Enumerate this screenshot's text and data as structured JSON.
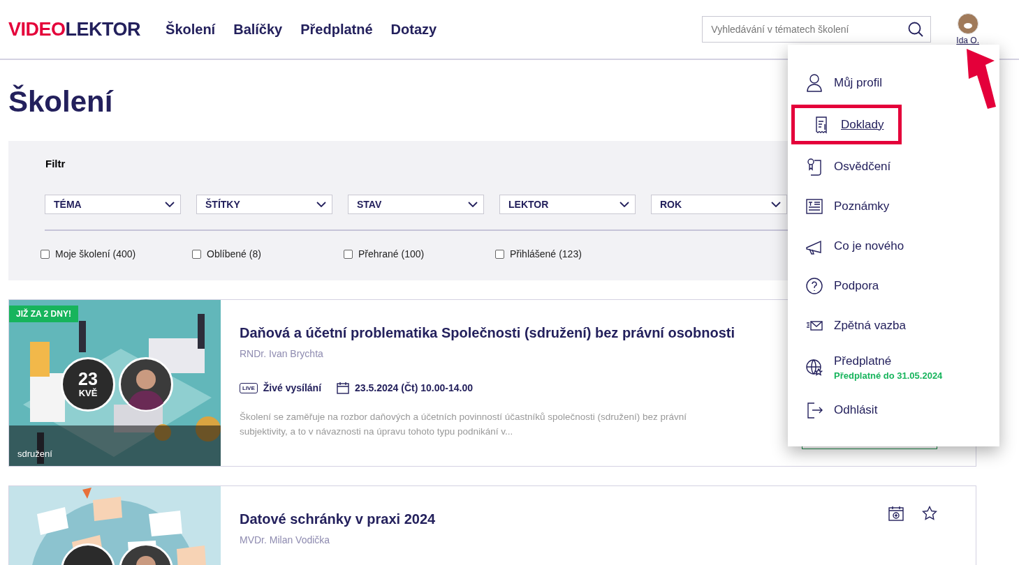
{
  "logo": {
    "part_1": "VIDEO",
    "part_2": "LEKTOR"
  },
  "nav": [
    "Školení",
    "Balíčky",
    "Předplatné",
    "Dotazy"
  ],
  "search": {
    "placeholder": "Vyhledávání v tématech školení"
  },
  "user": {
    "name": "Ida O."
  },
  "page_title": "Školení",
  "filter": {
    "title": "Filtr",
    "selects": [
      "TÉMA",
      "ŠTÍTKY",
      "STAV",
      "LEKTOR",
      "ROK"
    ],
    "checkboxes": [
      {
        "label": "Moje školení",
        "count": "(400)",
        "checked": false
      },
      {
        "label": "Oblíbené",
        "count": "(8)",
        "checked": false
      },
      {
        "label": "Přehrané",
        "count": "(100)",
        "checked": false
      },
      {
        "label": "Přihlášené",
        "count": "(123)",
        "checked": false
      }
    ]
  },
  "trainings": [
    {
      "badge": "JIŽ ZA 2 DNY!",
      "day": "23",
      "month": "KVĚ",
      "category": "sdružení",
      "title": "Daňová a účetní problematika Společnosti (sdružení) bez právní osobnosti",
      "lecturer": "RNDr. Ivan Brychta",
      "live_badge": "LIVE",
      "mode": "Živé vysílání",
      "date": "23.5.2024 (Čt) 10.00-14.00",
      "description": "Školení se zaměřuje na rozbor daňových a účetních povinností účastníků společnosti (sdružení) bez právní subjektivity, a to v návaznosti na úpravu tohoto typu podnikání v..."
    },
    {
      "title": "Datové schránky v praxi 2024",
      "lecturer": "MVDr. Milan Vodička",
      "actions": true
    }
  ],
  "user_menu": {
    "items": [
      {
        "label": "Můj profil",
        "highlighted": false
      },
      {
        "label": "Doklady",
        "highlighted": true
      },
      {
        "label": "Osvědčení",
        "highlighted": false
      },
      {
        "label": "Poznámky",
        "highlighted": false
      },
      {
        "label": "Co je nového",
        "highlighted": false
      },
      {
        "label": "Podpora",
        "highlighted": false
      },
      {
        "label": "Zpětná vazba",
        "highlighted": false
      },
      {
        "label": "Předplatné",
        "note": "Předplatné do 31.05.2024",
        "highlighted": false
      },
      {
        "label": "Odhlásit",
        "highlighted": false
      }
    ]
  },
  "annotation": {
    "arrow": true
  }
}
